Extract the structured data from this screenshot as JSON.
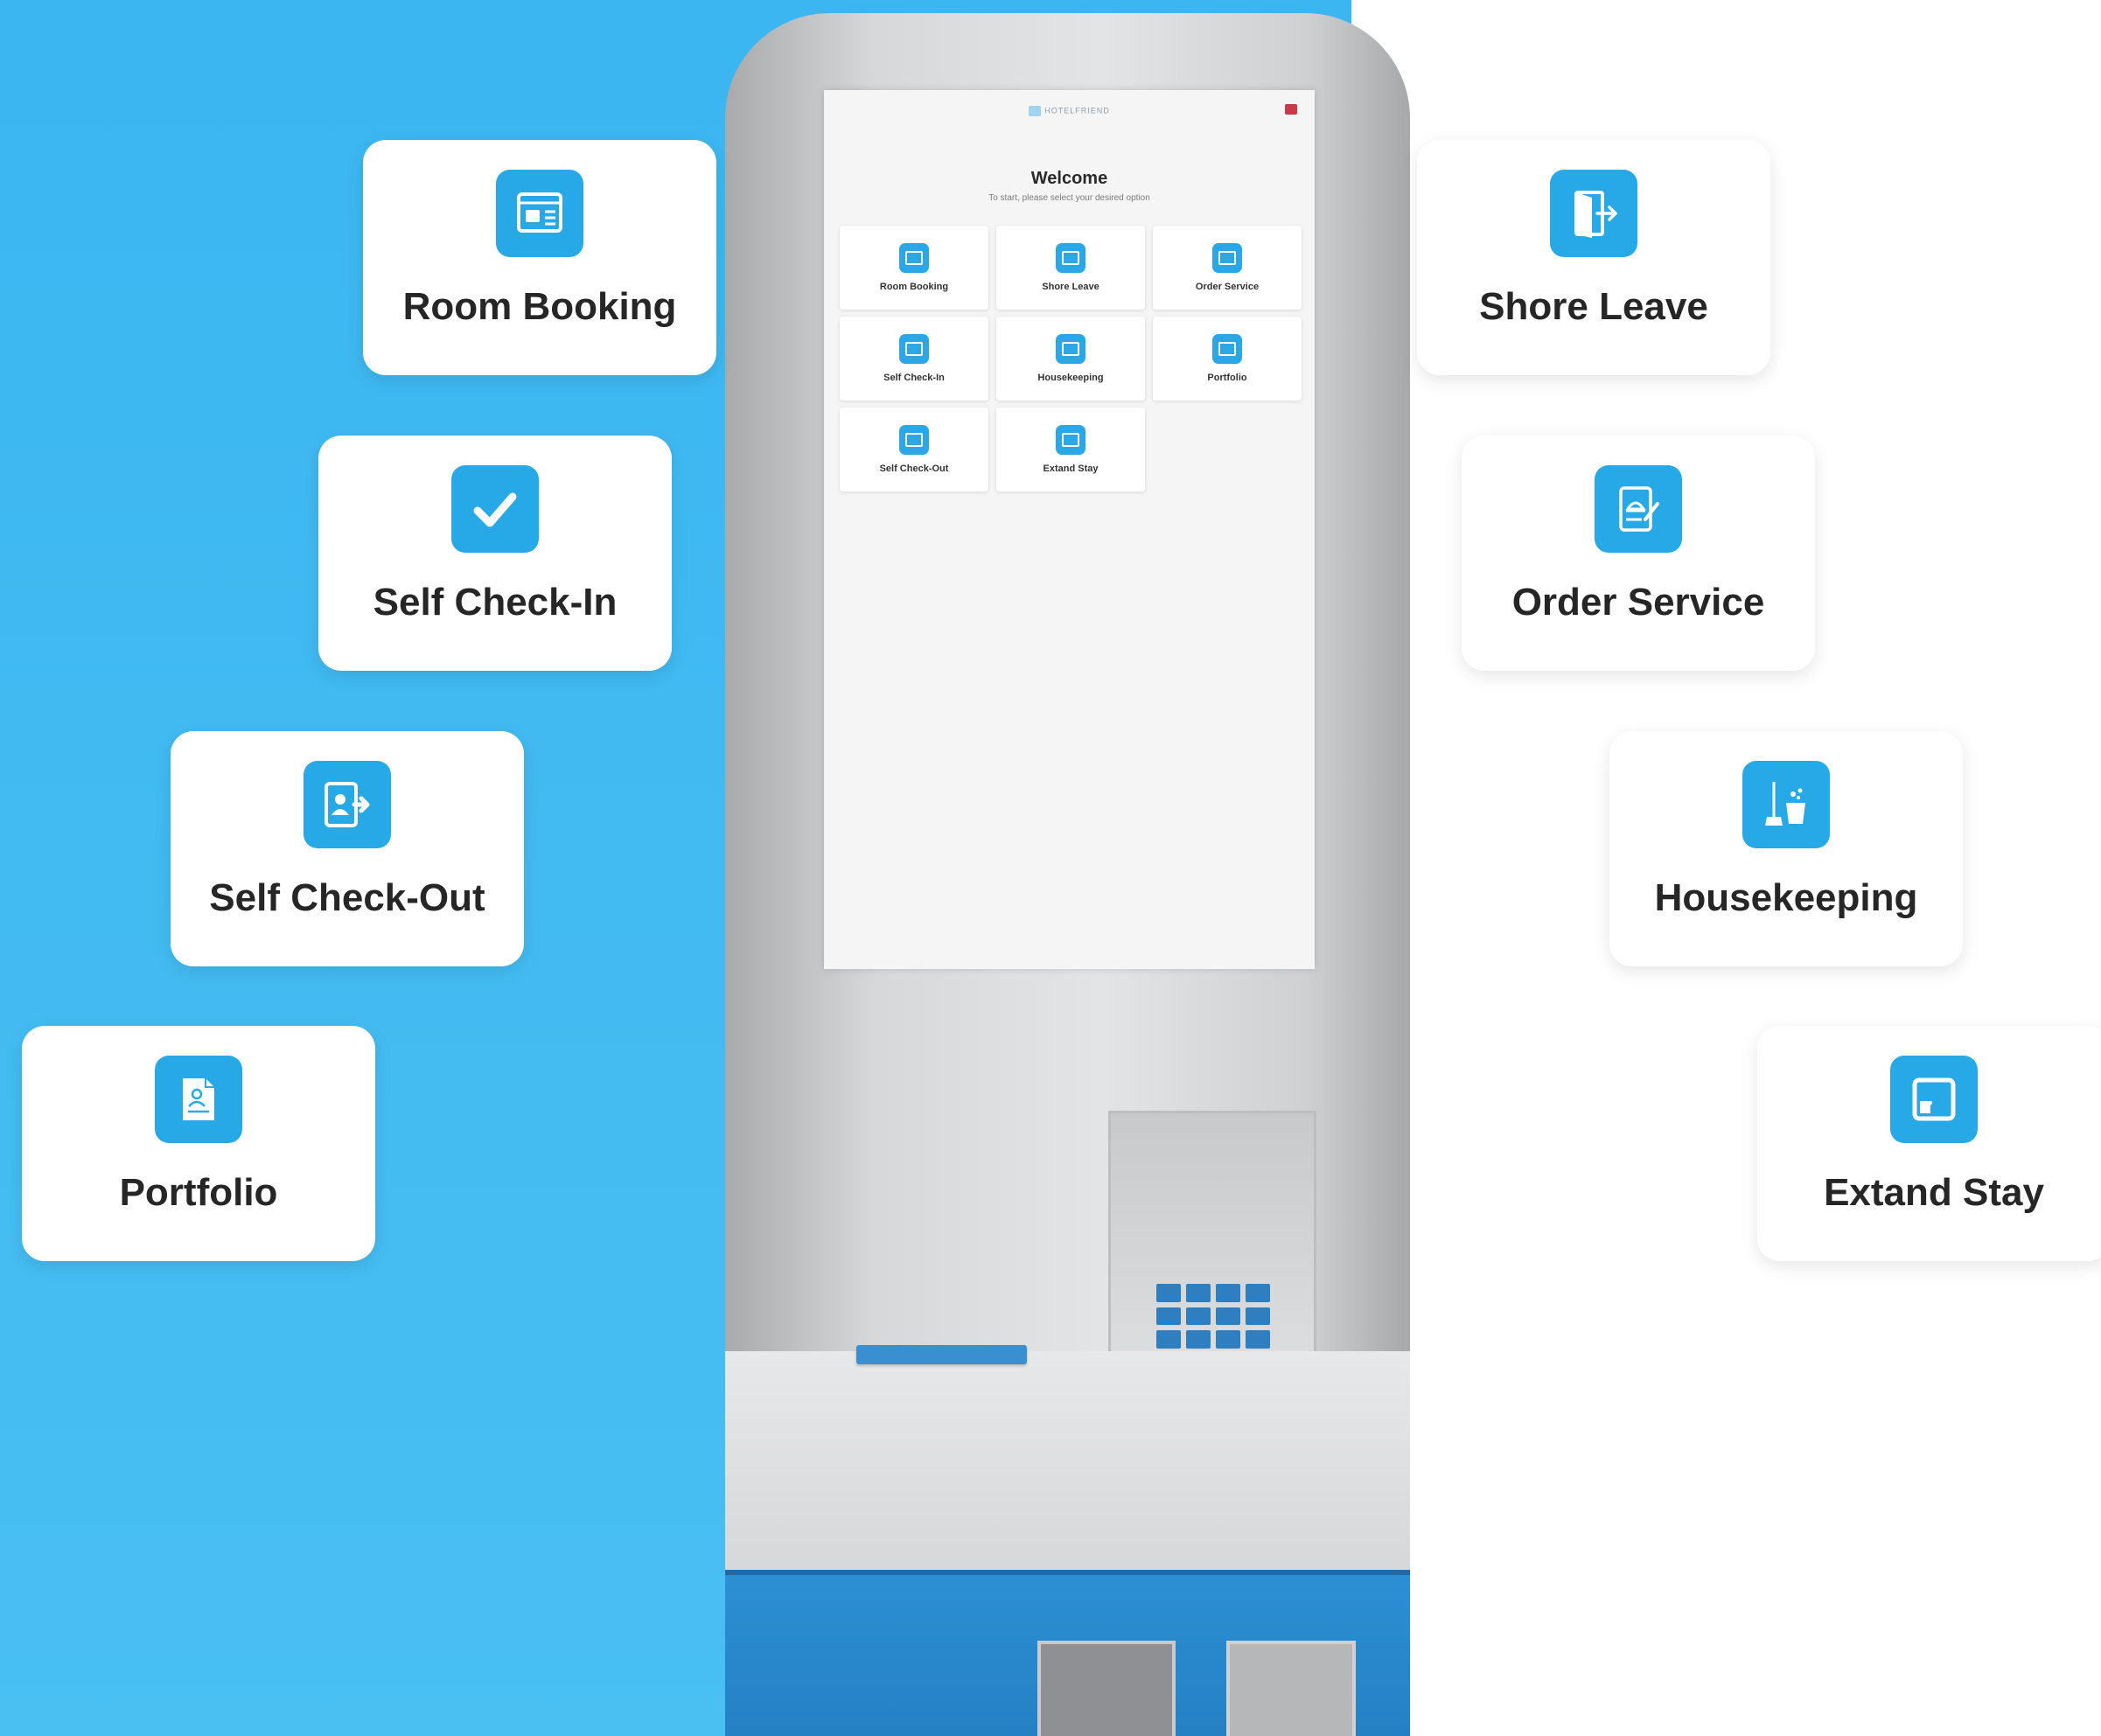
{
  "kiosk": {
    "screen": {
      "logo_text": "HOTELFRIEND",
      "title": "Welcome",
      "subtitle": "To start, please select your desired option",
      "tiles": [
        {
          "label": "Room Booking"
        },
        {
          "label": "Shore Leave"
        },
        {
          "label": "Order Service"
        },
        {
          "label": "Self Check-In"
        },
        {
          "label": "Housekeeping"
        },
        {
          "label": "Portfolio"
        },
        {
          "label": "Self Check-Out"
        },
        {
          "label": "Extand Stay"
        }
      ]
    }
  },
  "features": {
    "room_booking": {
      "label": "Room Booking",
      "icon": "room-booking-icon"
    },
    "self_check_in": {
      "label": "Self Check-In",
      "icon": "checkmark-icon"
    },
    "self_check_out": {
      "label": "Self Check-Out",
      "icon": "user-exit-icon"
    },
    "portfolio": {
      "label": "Portfolio",
      "icon": "document-user-icon"
    },
    "shore_leave": {
      "label": "Shore Leave",
      "icon": "door-exit-icon"
    },
    "order_service": {
      "label": "Order Service",
      "icon": "service-bell-clipboard-icon"
    },
    "housekeeping": {
      "label": "Housekeeping",
      "icon": "broom-bucket-icon"
    },
    "extand_stay": {
      "label": "Extand Stay",
      "icon": "expand-arrow-icon"
    }
  },
  "colors": {
    "accent": "#27a9e8",
    "background_left": "#43bbf2",
    "card": "#ffffff",
    "text": "#262626"
  }
}
